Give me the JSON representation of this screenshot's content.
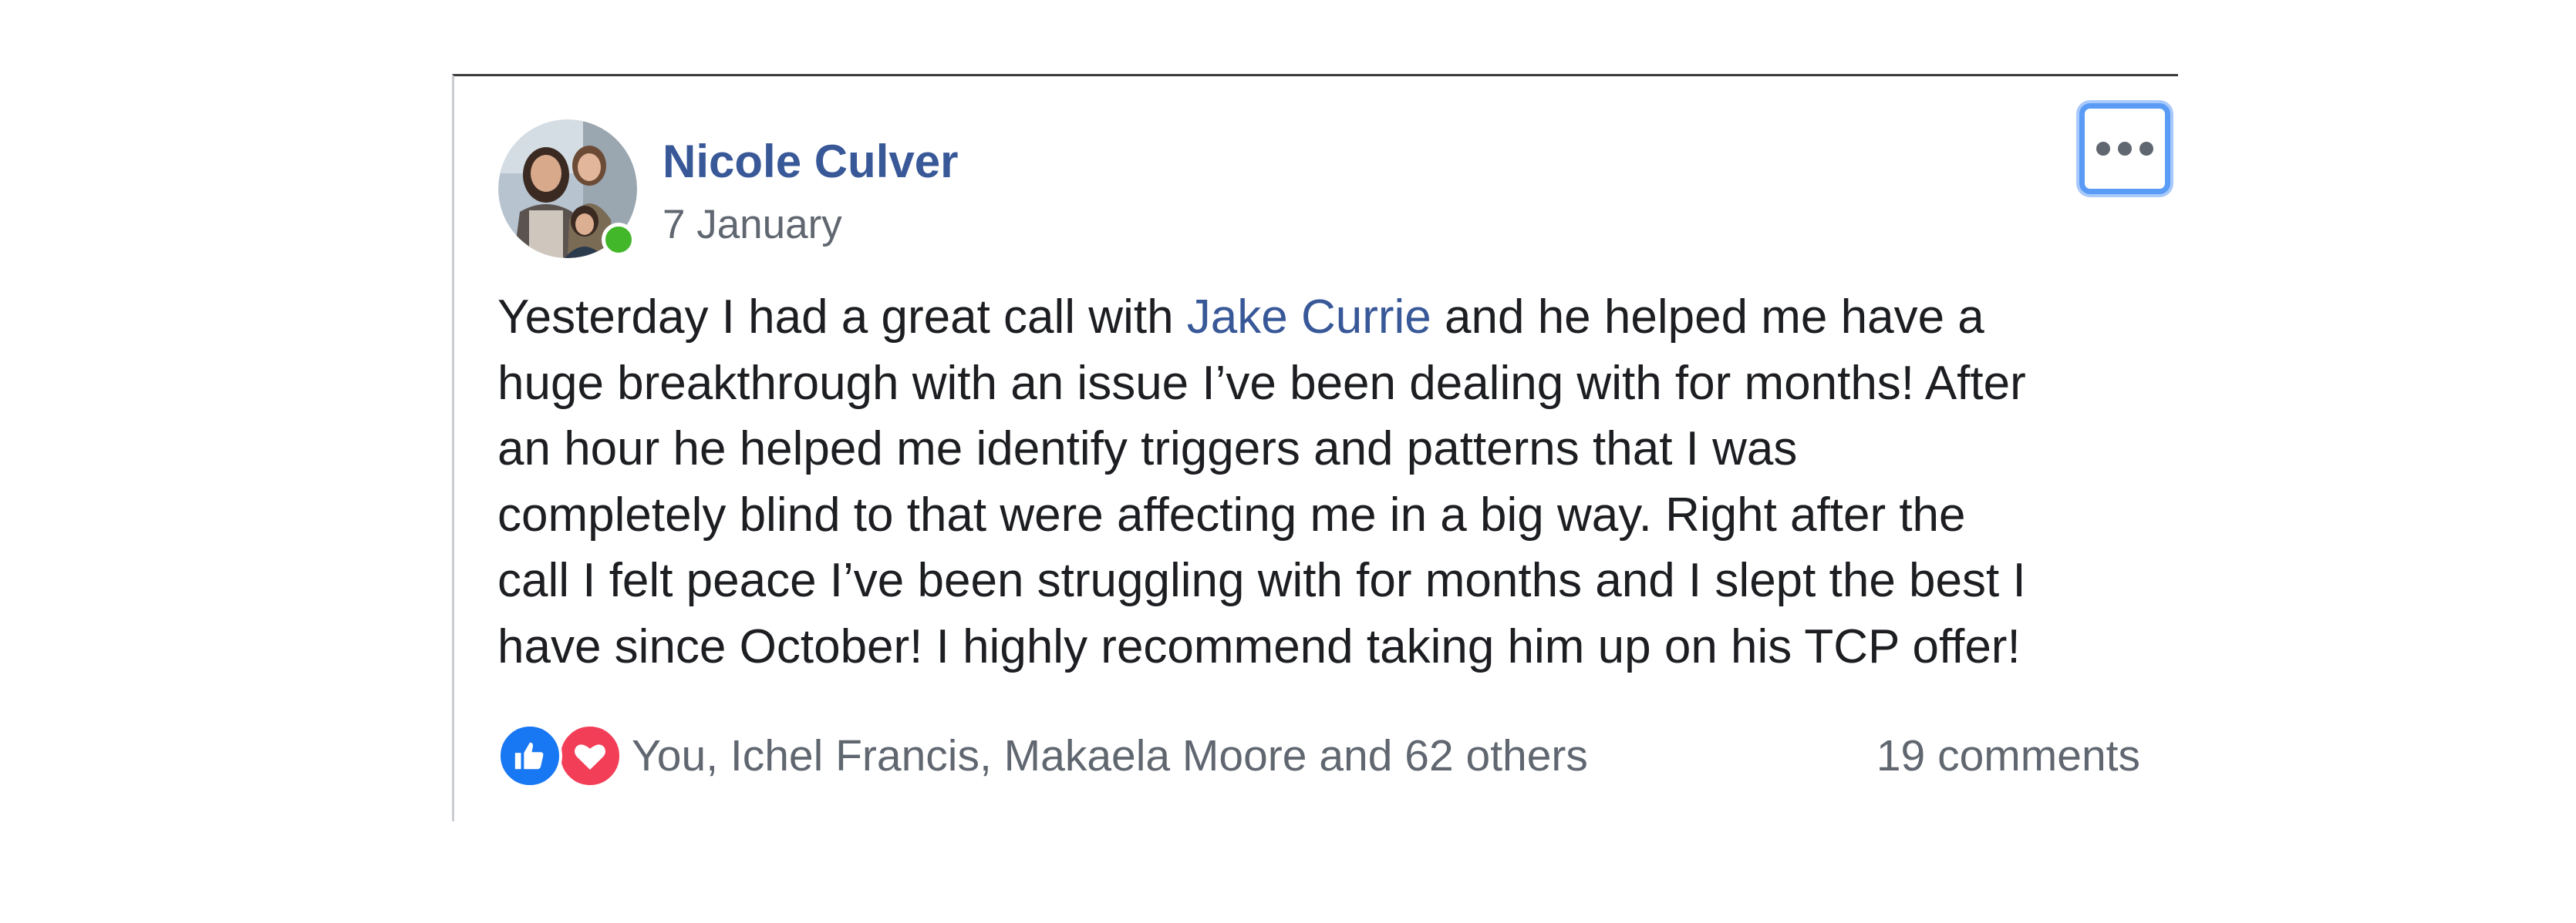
{
  "post": {
    "author": {
      "name": "Nicole Culver",
      "online": true
    },
    "date": "7 January",
    "options_icon": "more-horizontal-icon",
    "text": {
      "line1_before": "Yesterday I had a great call with ",
      "mention": "Jake Currie",
      "line1_after": " and he helped me have a",
      "line2": "huge breakthrough with an issue I’ve been dealing with for months! After",
      "line3": "an hour he helped me identify triggers and patterns that I was",
      "line4": "completely blind to that were affecting me in a big way. Right after the",
      "line5": "call I felt peace I’ve been struggling with for months and I slept the best I",
      "line6": "have since October! I highly recommend taking him up on his TCP offer!"
    },
    "reactions": {
      "icons": [
        "like-icon",
        "love-icon"
      ],
      "summary": "You, Ichel Francis, Makaela Moore and 62 others"
    },
    "comments": "19 comments"
  },
  "colors": {
    "link": "#385898",
    "secondary_text": "#606770",
    "body_text": "#1c1e21",
    "like": "#1877f2",
    "love": "#f33e58",
    "online": "#42b72a",
    "focus_ring": "#5a9bf5"
  }
}
